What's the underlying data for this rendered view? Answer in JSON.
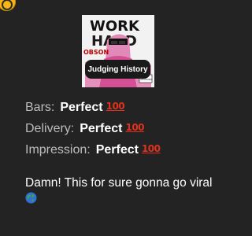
{
  "header": {
    "badge_icon": "app-badge-icon",
    "badge_color": "#f6b416"
  },
  "cover": {
    "art_text_line1": "WORK",
    "art_text_line2": "HARD",
    "art_text_small": "OBSON",
    "art_text_rating": "ADVISORY",
    "judging_button_label": "Judging History"
  },
  "ratings": [
    {
      "label": "Bars:",
      "value": "Perfect",
      "icon": "hundred-points-icon"
    },
    {
      "label": "Delivery:",
      "value": "Perfect",
      "icon": "hundred-points-icon"
    },
    {
      "label": "Impression:",
      "value": "Perfect",
      "icon": "hundred-points-icon"
    }
  ],
  "comment": {
    "text": "Damn! This for sure gonna go viral",
    "icon": "globe-icon"
  },
  "colors": {
    "background": "#232323",
    "label": "#bdbdbd",
    "value": "#ffffff",
    "hundred": "#e0311e"
  }
}
